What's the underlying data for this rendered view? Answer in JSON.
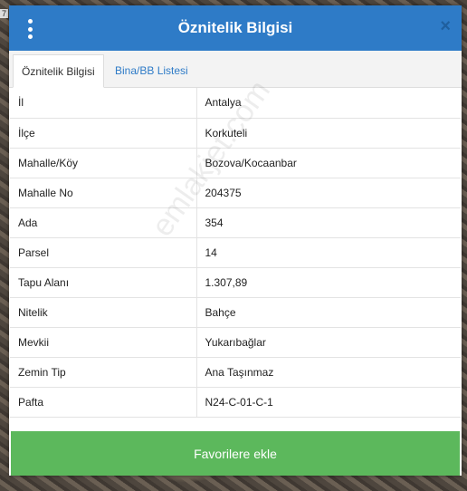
{
  "corner_label": "7",
  "dialog": {
    "title": "Öznitelik Bilgisi",
    "close_glyph": "×"
  },
  "tabs": [
    {
      "label": "Öznitelik Bilgisi",
      "active": true
    },
    {
      "label": "Bina/BB Listesi",
      "active": false
    }
  ],
  "rows": [
    {
      "label": "İl",
      "value": "Antalya"
    },
    {
      "label": "İlçe",
      "value": "Korkuteli"
    },
    {
      "label": "Mahalle/Köy",
      "value": "Bozova/Kocaanbar"
    },
    {
      "label": "Mahalle No",
      "value": "204375"
    },
    {
      "label": "Ada",
      "value": "354"
    },
    {
      "label": "Parsel",
      "value": "14"
    },
    {
      "label": "Tapu Alanı",
      "value": "1.307,89"
    },
    {
      "label": "Nitelik",
      "value": "Bahçe"
    },
    {
      "label": "Mevkii",
      "value": "Yukarıbağlar"
    },
    {
      "label": "Zemin Tip",
      "value": "Ana Taşınmaz"
    },
    {
      "label": "Pafta",
      "value": "N24-C-01-C-1"
    }
  ],
  "footer": {
    "button_label": "Favorilere ekle"
  },
  "watermark": "emlakjet.com",
  "colors": {
    "header": "#2e7bc7",
    "button": "#5cb85c",
    "tab_link": "#2e7bc7"
  }
}
